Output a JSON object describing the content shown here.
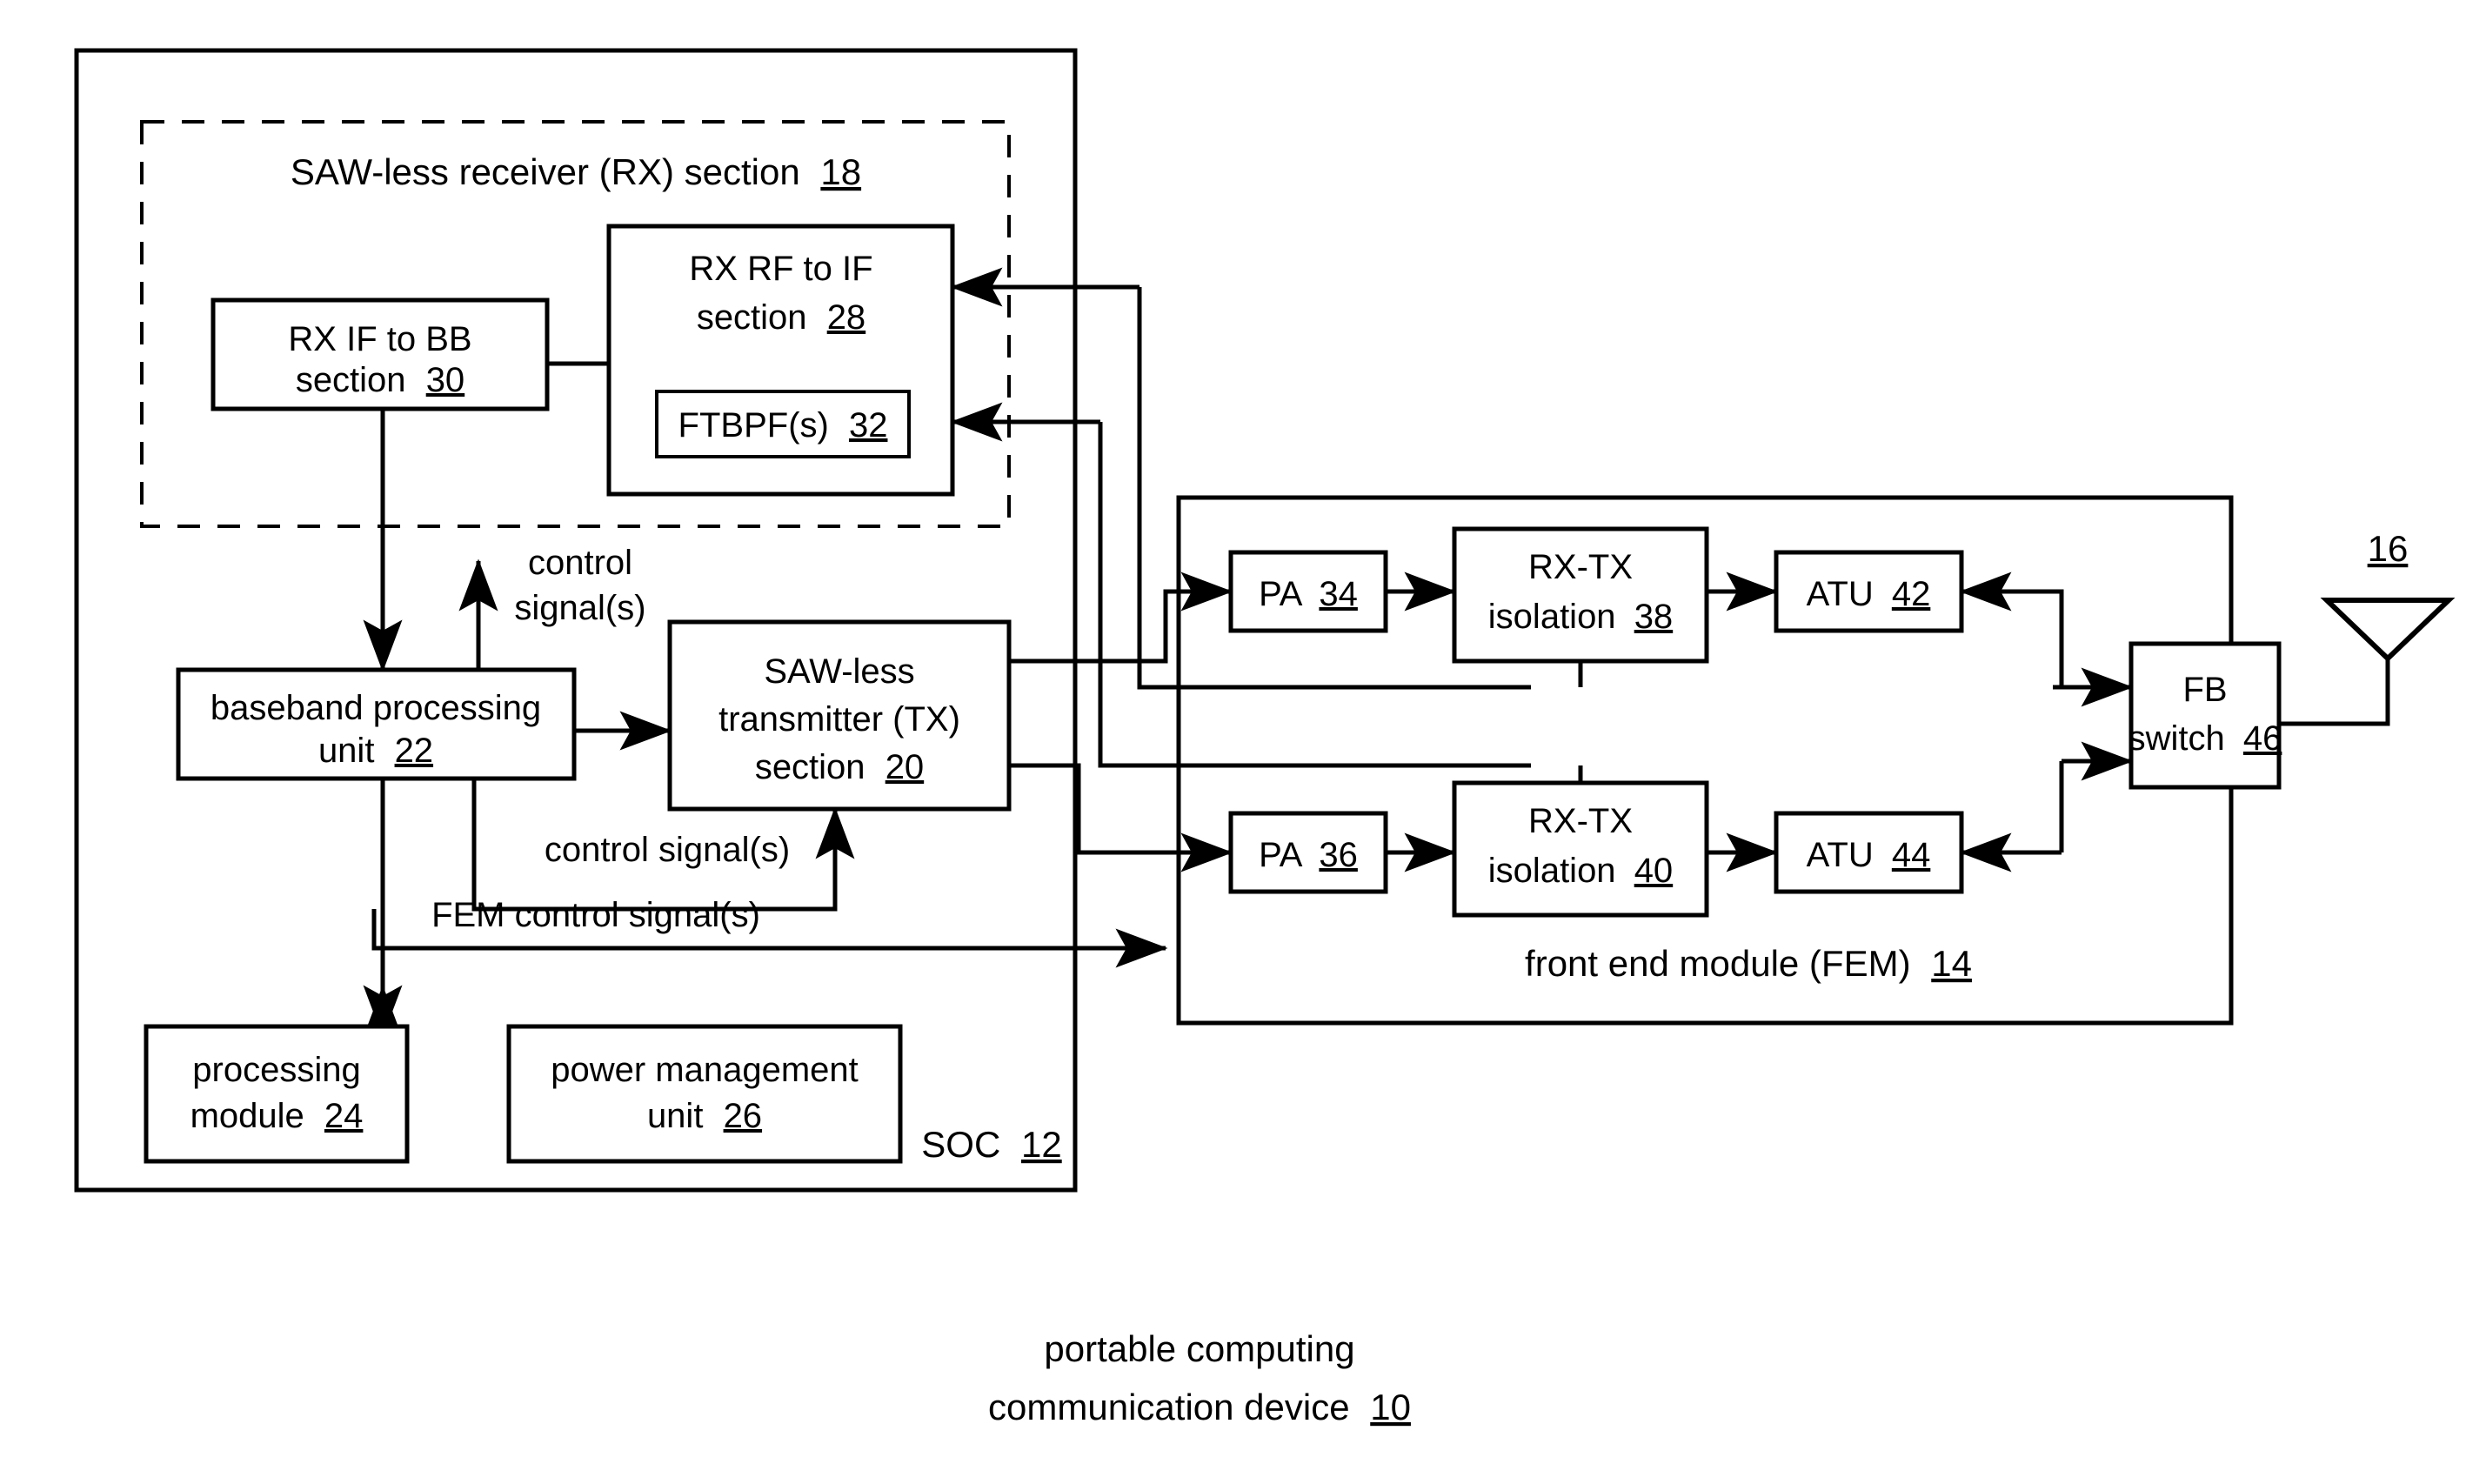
{
  "figure": {
    "caption_line1": "portable computing",
    "caption_line2": "communication device",
    "caption_ref": "10"
  },
  "soc": {
    "label": "SOC",
    "ref": "12"
  },
  "rx_section": {
    "label": "SAW-less receiver (RX) section",
    "ref": "18"
  },
  "blocks": {
    "rx_if_to_bb": {
      "line1": "RX IF to BB",
      "line2": "section",
      "ref": "30"
    },
    "rx_rf_to_if": {
      "line1": "RX RF to IF",
      "line2": "section",
      "ref": "28"
    },
    "ftbpf": {
      "line1": "FTBPF(s)",
      "ref": "32"
    },
    "baseband": {
      "line1": "baseband processing",
      "line2": "unit",
      "ref": "22"
    },
    "tx_section": {
      "line1": "SAW-less",
      "line2": "transmitter (TX)",
      "line3": "section",
      "ref": "20"
    },
    "processing_module": {
      "line1": "processing",
      "line2": "module",
      "ref": "24"
    },
    "power_management": {
      "line1": "power management",
      "line2": "unit",
      "ref": "26"
    },
    "pa_34": {
      "line1": "PA",
      "ref": "34"
    },
    "pa_36": {
      "line1": "PA",
      "ref": "36"
    },
    "isolation_38": {
      "line1": "RX-TX",
      "line2": "isolation",
      "ref": "38"
    },
    "isolation_40": {
      "line1": "RX-TX",
      "line2": "isolation",
      "ref": "40"
    },
    "atu_42": {
      "line1": "ATU",
      "ref": "42"
    },
    "atu_44": {
      "line1": "ATU",
      "ref": "44"
    },
    "fb_switch": {
      "line1": "FB",
      "line2": "switch",
      "ref": "46"
    }
  },
  "fem": {
    "label": "front end module (FEM)",
    "ref": "14"
  },
  "antenna": {
    "ref": "16"
  },
  "annotations": {
    "control_signals_rx_line1": "control",
    "control_signals_rx_line2": "signal(s)",
    "control_signals_tx": "control signal(s)",
    "fem_control_signals": "FEM control signal(s)"
  },
  "colors": {
    "line": "#000000",
    "background": "#ffffff"
  }
}
